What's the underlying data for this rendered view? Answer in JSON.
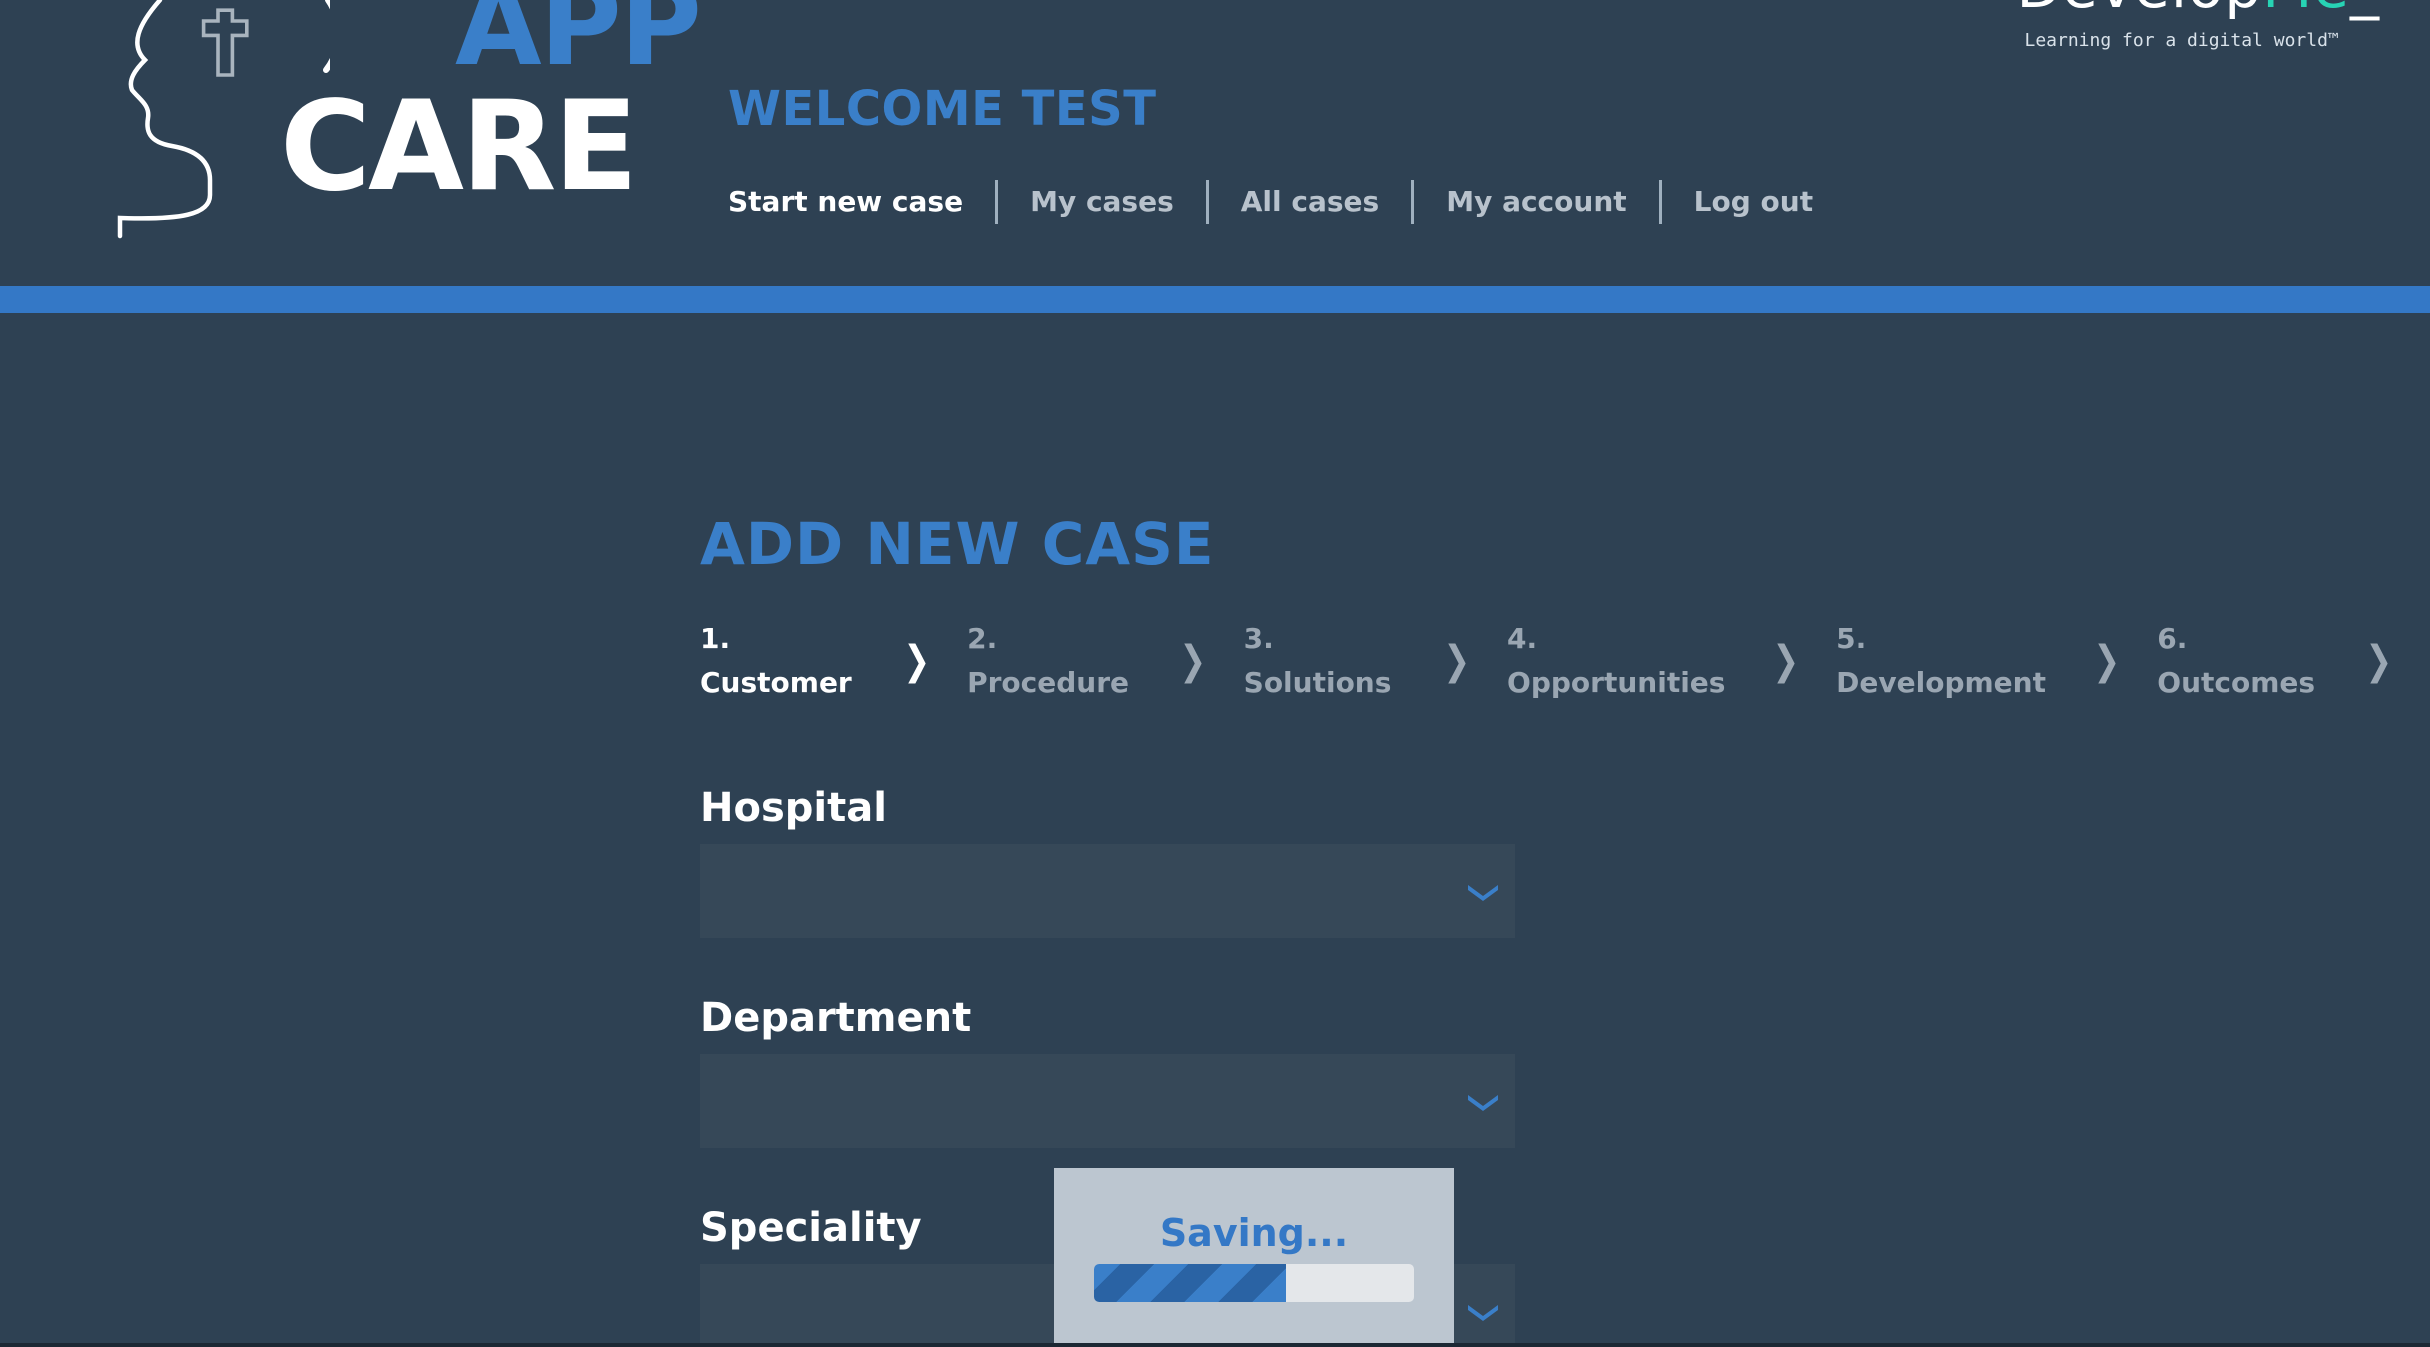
{
  "logo": {
    "app": "APP",
    "care": "CARE"
  },
  "brand": {
    "name_main": "Develop",
    "name_highlight": "Me",
    "name_suffix": "_",
    "tagline": "Learning for a digital world™"
  },
  "header": {
    "welcome": "WELCOME TEST"
  },
  "nav": {
    "items": [
      {
        "label": "Start new case",
        "active": true
      },
      {
        "label": "My cases",
        "active": false
      },
      {
        "label": "All cases",
        "active": false
      },
      {
        "label": "My account",
        "active": false
      },
      {
        "label": "Log out",
        "active": false
      }
    ]
  },
  "page": {
    "title": "ADD NEW CASE"
  },
  "steps": [
    {
      "label": "1. Customer",
      "active": true
    },
    {
      "label": "2. Procedure",
      "active": false
    },
    {
      "label": "3. Solutions",
      "active": false
    },
    {
      "label": "4. Opportunities",
      "active": false
    },
    {
      "label": "5. Development",
      "active": false
    },
    {
      "label": "6. Outcomes",
      "active": false
    }
  ],
  "form": {
    "fields": [
      {
        "label": "Hospital",
        "value": ""
      },
      {
        "label": "Department",
        "value": ""
      },
      {
        "label": "Speciality",
        "value": ""
      }
    ]
  },
  "overlay": {
    "text": "Saving...",
    "progress": 0.6
  },
  "colors": {
    "background": "#2e4153",
    "accent": "#3a7fc9",
    "band": "#3478c6",
    "brand_highlight": "#27d3b4"
  }
}
